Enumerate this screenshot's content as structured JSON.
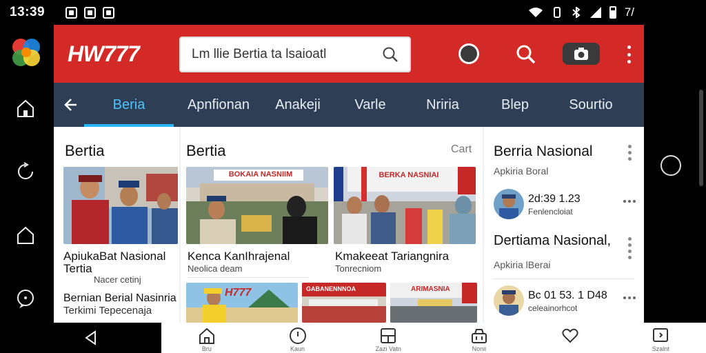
{
  "status_bar": {
    "time": "13:39",
    "battery_text": "7/"
  },
  "app": {
    "brand": "HW777",
    "search": {
      "value": "",
      "placeholder": "Lm llie Bertia ta lsaioatl"
    },
    "accent_color": "#d32a27",
    "tab_bar_color": "#2e3f55",
    "tabs": [
      {
        "label": "Beria",
        "active": true
      },
      {
        "label": "Apnfionan",
        "active": false
      },
      {
        "label": "Anakeji",
        "active": false
      },
      {
        "label": "Varle",
        "active": false
      },
      {
        "label": "Nriria",
        "active": false
      },
      {
        "label": "Blep",
        "active": false
      },
      {
        "label": "Sourtio",
        "active": false
      }
    ]
  },
  "left_column": {
    "title": "Bertia",
    "card": {
      "headline1": "ApiukaBat Nasional",
      "headline2": "Tertia",
      "meta": "Nacer cetinj"
    },
    "card2": {
      "headline": "Bernian Berial Nasinria",
      "subline": "Terkimi Tepecenaja"
    }
  },
  "middle_column": {
    "title": "Bertia",
    "cart_label": "Cart",
    "cards": [
      {
        "banner": "BOKAIA NASNIIM",
        "headline": "Kenca KanIhrajenal",
        "meta": "Neolica deam"
      },
      {
        "banner": "BERKA NASNIAI",
        "headline": "Kmakeeat Tariangnira",
        "meta": "Tonrecniom"
      }
    ],
    "bottom_cards": [
      {
        "banner": "H777"
      },
      {
        "banner": "GABANENNNOA"
      },
      {
        "banner": "ARIMASNIA"
      }
    ]
  },
  "right_column": {
    "title": "Berria Nasional",
    "subtitle": "Apkiria Boral",
    "item1": {
      "title": "2d:39 1.23",
      "sub": "Fenlencloiat"
    },
    "title2": "Dertiama Nasional,",
    "subtitle2": "Apkiria lBerai",
    "item2": {
      "title": "Bc 01 53. 1 D48",
      "sub": "celeainorhcot"
    }
  },
  "bottom_nav": [
    {
      "icon": "home-icon",
      "label": "Bru"
    },
    {
      "icon": "clock-icon",
      "label": "Kaun"
    },
    {
      "icon": "grid-icon",
      "label": "Zazi Vatn"
    },
    {
      "icon": "basket-icon",
      "label": "Nonii"
    },
    {
      "icon": "heart-icon",
      "label": ""
    },
    {
      "icon": "chat-icon",
      "label": "Szalnt"
    }
  ]
}
